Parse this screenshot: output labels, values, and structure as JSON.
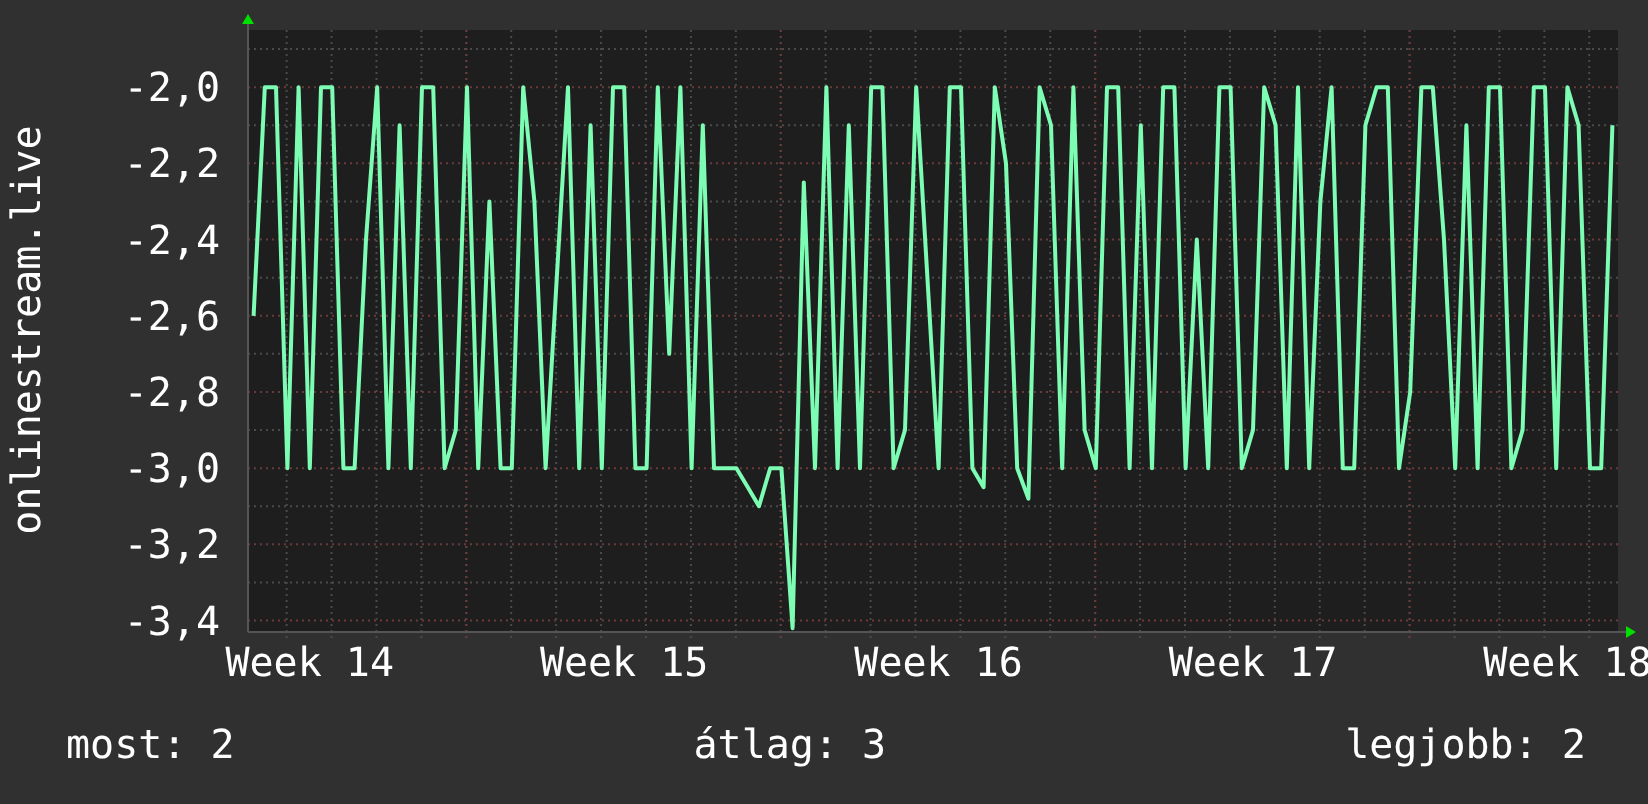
{
  "chart": {
    "chart_data": {
      "type": "line",
      "ylabel": "onlinestream.live",
      "grid": true,
      "categories": [
        null,
        null,
        null,
        null,
        null,
        "Week 14",
        null,
        null,
        null,
        null,
        null,
        null,
        null,
        null,
        null,
        null,
        null,
        null,
        null,
        null,
        null,
        null,
        null,
        null,
        null,
        null,
        null,
        null,
        null,
        null,
        null,
        null,
        null,
        "Week 15",
        null,
        null,
        null,
        null,
        null,
        null,
        null,
        null,
        null,
        null,
        null,
        null,
        null,
        null,
        null,
        null,
        null,
        null,
        null,
        null,
        null,
        null,
        null,
        null,
        null,
        null,
        null,
        "Week 16",
        null,
        null,
        null,
        null,
        null,
        null,
        null,
        null,
        null,
        null,
        null,
        null,
        null,
        null,
        null,
        null,
        null,
        null,
        null,
        null,
        null,
        null,
        null,
        null,
        null,
        null,
        null,
        "Week 17",
        null,
        null,
        null,
        null,
        null,
        null,
        null,
        null,
        null,
        null,
        null,
        null,
        null,
        null,
        null,
        null,
        null,
        null,
        null,
        null,
        null,
        null,
        null,
        null,
        null,
        null,
        null,
        "Week 18",
        null,
        null,
        null,
        null
      ],
      "ylim": [
        -3.43,
        -1.85
      ],
      "yticks": [
        {
          "value": -2.0,
          "label": "-2,0"
        },
        {
          "value": -2.2,
          "label": "-2,2"
        },
        {
          "value": -2.4,
          "label": "-2,4"
        },
        {
          "value": -2.6,
          "label": "-2,6"
        },
        {
          "value": -2.8,
          "label": "-2,8"
        },
        {
          "value": -3.0,
          "label": "-3,0"
        },
        {
          "value": -3.2,
          "label": "-3,2"
        },
        {
          "value": -3.4,
          "label": "-3,4"
        }
      ],
      "series": [
        {
          "color": "#7dfcb4",
          "values": [
            -2.6,
            -2.0,
            -2.0,
            -3.0,
            -2.0,
            -3.0,
            -2.0,
            -2.0,
            -3.0,
            -3.0,
            -2.4,
            -2.0,
            -3.0,
            -2.1,
            -3.0,
            -2.0,
            -2.0,
            -3.0,
            -2.9,
            -2.0,
            -3.0,
            -2.3,
            -3.0,
            -3.0,
            -2.0,
            -2.3,
            -3.0,
            -2.5,
            -2.0,
            -3.0,
            -2.1,
            -3.0,
            -2.0,
            -2.0,
            -3.0,
            -3.0,
            -2.0,
            -2.7,
            -2.0,
            -3.0,
            -2.1,
            -3.0,
            -3.0,
            -3.0,
            -3.05,
            -3.1,
            -3.0,
            -3.0,
            -3.42,
            -2.25,
            -3.0,
            -2.0,
            -3.0,
            -2.1,
            -3.0,
            -2.0,
            -2.0,
            -3.0,
            -2.9,
            -2.0,
            -2.5,
            -3.0,
            -2.0,
            -2.0,
            -3.0,
            -3.05,
            -2.0,
            -2.2,
            -3.0,
            -3.08,
            -2.0,
            -2.1,
            -3.0,
            -2.0,
            -2.9,
            -3.0,
            -2.0,
            -2.0,
            -3.0,
            -2.1,
            -3.0,
            -2.0,
            -2.0,
            -3.0,
            -2.4,
            -3.0,
            -2.0,
            -2.0,
            -3.0,
            -2.9,
            -2.0,
            -2.1,
            -3.0,
            -2.0,
            -3.0,
            -2.3,
            -2.0,
            -3.0,
            -3.0,
            -2.1,
            -2.0,
            -2.0,
            -3.0,
            -2.8,
            -2.0,
            -2.0,
            -2.4,
            -3.0,
            -2.1,
            -3.0,
            -2.0,
            -2.0,
            -3.0,
            -2.9,
            -2.0,
            -2.0,
            -3.0,
            -2.0,
            -2.1,
            -3.0,
            -3.0,
            -2.1
          ]
        }
      ]
    }
  },
  "summary": [
    {
      "label": "most: 2"
    },
    {
      "label": "átlag: 3"
    },
    {
      "label": "legjobb: 2"
    }
  ]
}
